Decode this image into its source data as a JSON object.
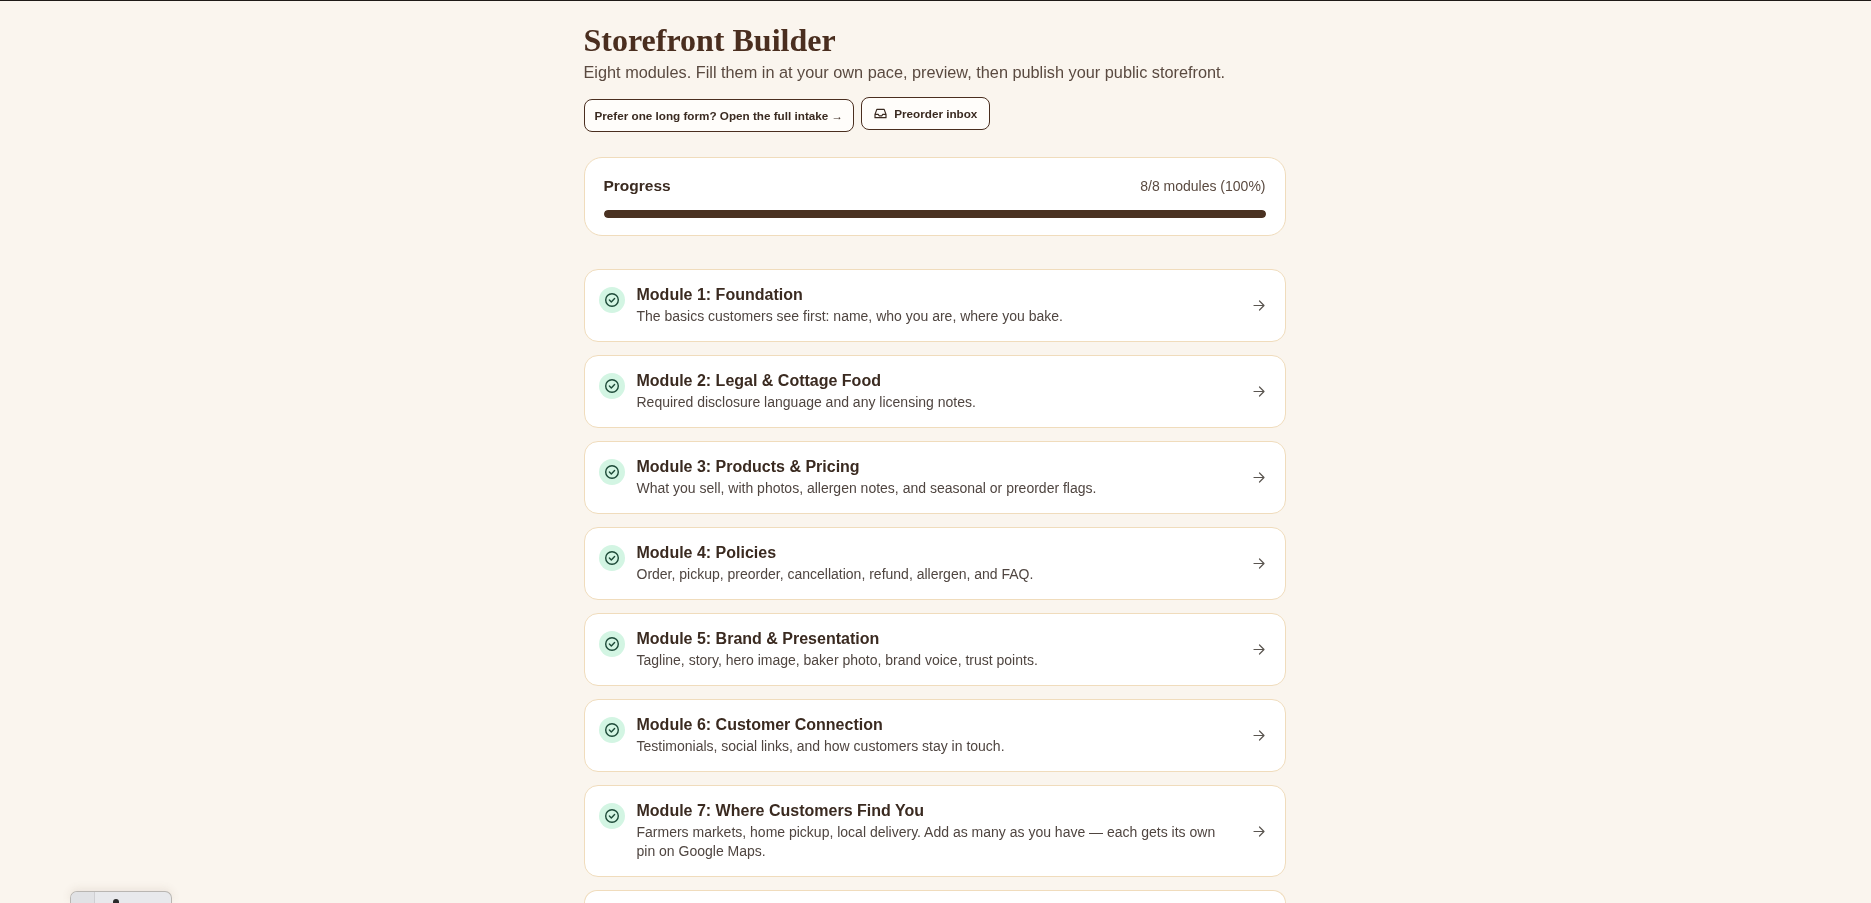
{
  "header": {
    "title": "Storefront Builder",
    "subtitle": "Eight modules. Fill them in at your own pace, preview, then publish your public storefront.",
    "buttons": [
      {
        "label": "Prefer one long form? Open the full intake →",
        "kind": "plain"
      },
      {
        "label": "Preorder inbox",
        "kind": "inbox"
      }
    ]
  },
  "progress": {
    "label": "Progress",
    "reading": "8/8 modules (100%)",
    "level": 1
  },
  "modules": [
    {
      "title": "Module 1: Foundation",
      "description": "The basics customers see first: name, who you are, where you bake.",
      "done": true
    },
    {
      "title": "Module 2: Legal & Cottage Food",
      "description": "Required disclosure language and any licensing notes.",
      "done": true
    },
    {
      "title": "Module 3: Products & Pricing",
      "description": "What you sell, with photos, allergen notes, and seasonal or preorder flags.",
      "done": true
    },
    {
      "title": "Module 4: Policies",
      "description": "Order, pickup, preorder, cancellation, refund, allergen, and FAQ.",
      "done": true
    },
    {
      "title": "Module 5: Brand & Presentation",
      "description": "Tagline, story, hero image, baker photo, brand voice, trust points.",
      "done": true
    },
    {
      "title": "Module 6: Customer Connection",
      "description": "Testimonials, social links, and how customers stay in touch.",
      "done": true
    },
    {
      "title": "Module 7: Where Customers Find You",
      "description": "Farmers markets, home pickup, local delivery. Add as many as you have — each gets its own pin on Google Maps.",
      "done": true
    }
  ]
}
